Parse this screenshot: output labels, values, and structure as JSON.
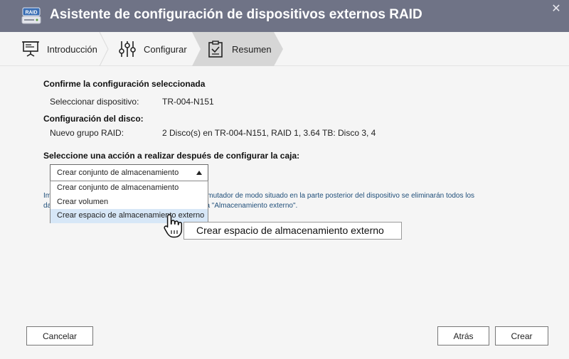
{
  "window": {
    "title": "Asistente de configuración de dispositivos externos RAID",
    "icon_text": "RAID",
    "close_glyph": "✕"
  },
  "steps": [
    {
      "label": "Introducción",
      "icon": "presentation-board-icon",
      "active": false
    },
    {
      "label": "Configurar",
      "icon": "sliders-icon",
      "active": false
    },
    {
      "label": "Resumen",
      "icon": "clipboard-check-icon",
      "active": true
    }
  ],
  "summary": {
    "heading": "Confirme la configuración seleccionada",
    "device_label": "Seleccionar dispositivo:",
    "device_value": "TR-004-N151",
    "disk_heading": "Configuración del disco:",
    "raid_label": "Nuevo grupo RAID:",
    "raid_value": "2 Disco(s) en TR-004-N151, RAID 1, 3.64 TB: Disco 3, 4"
  },
  "action": {
    "prompt": "Seleccione una acción a realizar después de configurar la caja:",
    "selected": "Crear conjunto de almacenamiento",
    "options": [
      "Crear conjunto de almacenamiento",
      "Crear volumen",
      "Crear espacio de almacenamiento externo"
    ],
    "highlighted_index": 2,
    "tooltip": "Crear espacio de almacenamiento externo"
  },
  "hint": {
    "line1_start": "Im",
    "line1_end": "onmutador de modo situado en la parte posterior del dispositivo se eliminarán todos los",
    "line2_start": "da",
    "line2_end": "o a \"Almacenamiento externo\"."
  },
  "buttons": {
    "cancel": "Cancelar",
    "back": "Atrás",
    "create": "Crear"
  },
  "colors": {
    "titlebar": "#6f7386",
    "hint_text": "#1f4e79",
    "dropdown_highlight": "#d7e7f7"
  }
}
